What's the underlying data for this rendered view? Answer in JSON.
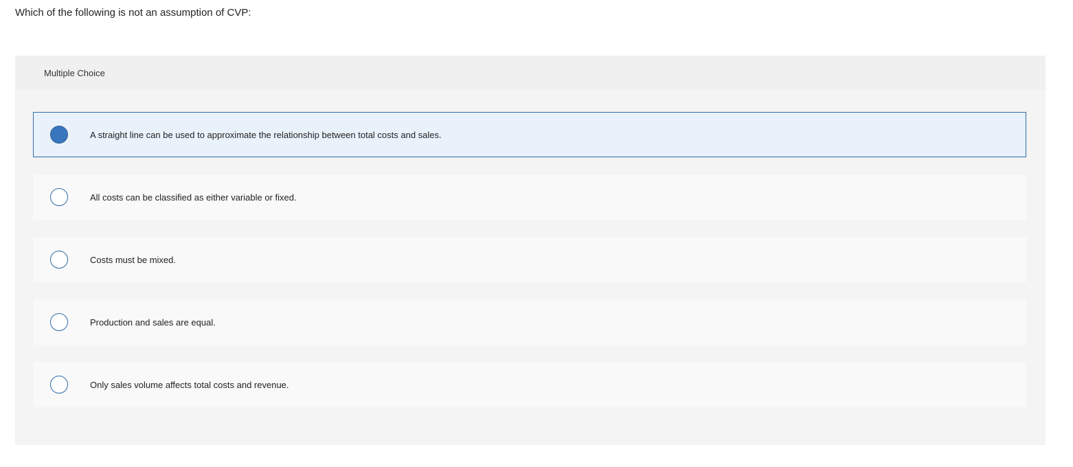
{
  "question": "Which of the following is not an assumption of CVP:",
  "panel": {
    "header": "Multiple Choice"
  },
  "choices": [
    {
      "label": "A straight line can be used to approximate the relationship between total costs and sales.",
      "selected": true
    },
    {
      "label": "All costs can be classified as either variable or fixed.",
      "selected": false
    },
    {
      "label": "Costs must be mixed.",
      "selected": false
    },
    {
      "label": "Production and sales are equal.",
      "selected": false
    },
    {
      "label": "Only sales volume affects total costs and revenue.",
      "selected": false
    }
  ],
  "colors": {
    "accent": "#2e6ca7",
    "selected_fill": "#3a76bd",
    "selected_bg": "#e9f1fb"
  }
}
